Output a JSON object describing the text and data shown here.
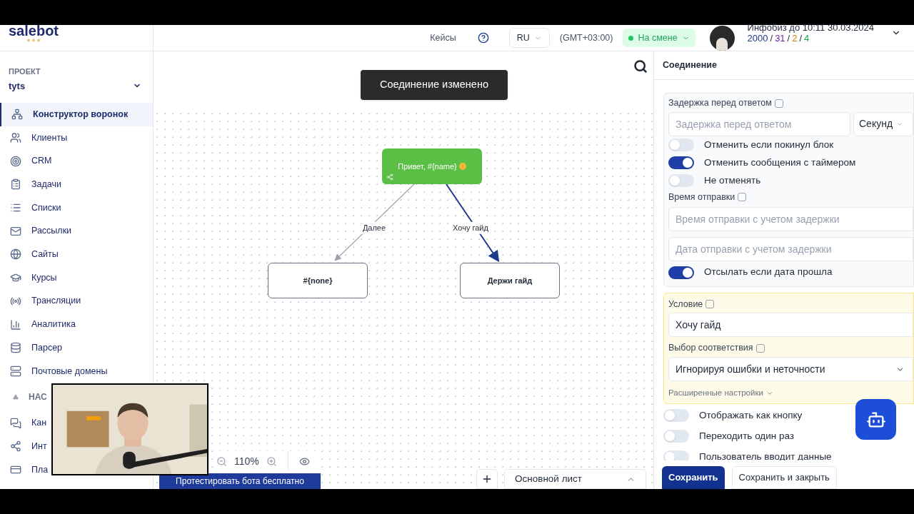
{
  "header": {
    "logo": "salebot",
    "links": [
      {
        "label": "Кейсы"
      }
    ],
    "language": "RU",
    "timezone": "(GMT+03:00)",
    "status": {
      "label": "На смене",
      "color": "#22c55e"
    },
    "account": {
      "title": "Инфобиз до 10:11 30.03.2024",
      "separator": "/",
      "counters": [
        {
          "value": "2000",
          "color": "#1e3a8a"
        },
        {
          "value": "31",
          "color": "#6b21a8"
        },
        {
          "value": "2",
          "color": "#d97706"
        },
        {
          "value": "4",
          "color": "#16a34a"
        }
      ]
    }
  },
  "sidebar": {
    "project_label": "ПРОЕКТ",
    "project": "tyts",
    "items": [
      {
        "label": "Конструктор воронок",
        "selected": true
      },
      {
        "label": "Клиенты",
        "selected": false
      },
      {
        "label": "CRM",
        "selected": false
      },
      {
        "label": "Задачи",
        "selected": false
      },
      {
        "label": "Списки",
        "selected": false
      },
      {
        "label": "Рассылки",
        "selected": false
      },
      {
        "label": "Сайты",
        "selected": false
      },
      {
        "label": "Курсы",
        "selected": false
      },
      {
        "label": "Трансляции",
        "selected": false
      },
      {
        "label": "Аналитика",
        "selected": false
      },
      {
        "label": "Парсер",
        "selected": false
      },
      {
        "label": "Почтовые домены",
        "selected": false
      }
    ],
    "section": {
      "label": "НАС",
      "expanded": true
    },
    "section_items": [
      {
        "label": "Кан"
      },
      {
        "label": "Инт"
      },
      {
        "label": "Пла"
      }
    ]
  },
  "canvas": {
    "toast": "Соединение изменено",
    "nodes": [
      {
        "kind": "start",
        "text": "Привет, #{name}"
      },
      {
        "kind": "message",
        "text": "#{none}"
      },
      {
        "kind": "message",
        "text": "Держи гайд"
      }
    ],
    "edges": [
      {
        "label": "Далее",
        "selected": false
      },
      {
        "label": "Хочу гайд",
        "selected": true
      }
    ],
    "zoom": "110%",
    "test_banner": "Протестировать бота бесплатно",
    "sheet": "Основной лист"
  },
  "panel": {
    "title": "Соединение",
    "delay": {
      "label": "Задержка перед ответом",
      "placeholder": "Задержка перед ответом",
      "unit": "Секунд"
    },
    "toggles": [
      {
        "label": "Отменить если покинул блок",
        "on": false
      },
      {
        "label": "Отменить сообщения с таймером",
        "on": true
      },
      {
        "label": "Не отменять",
        "on": false
      }
    ],
    "send_time": {
      "label": "Время отправки",
      "time_placeholder": "Время отправки с учетом задержки",
      "date_placeholder": "Дата отправки с учетом задержки"
    },
    "send_if_past": {
      "label": "Отсылать если дата прошла",
      "on": true
    },
    "condition": {
      "label": "Условие",
      "value": "Хочу гайд"
    },
    "match": {
      "label": "Выбор соответствия",
      "value": "Игнорируя ошибки и неточности"
    },
    "advanced": "Расширенные настройки",
    "options": [
      {
        "label": "Отображать как кнопку",
        "on": false
      },
      {
        "label": "Переходить один раз",
        "on": false
      },
      {
        "label": "Пользователь вводит данные",
        "on": false
      }
    ],
    "buttons": [
      {
        "label": "Сохранить",
        "kind": "primary"
      },
      {
        "label": "Сохранить и закрыть",
        "kind": "secondary"
      }
    ]
  }
}
